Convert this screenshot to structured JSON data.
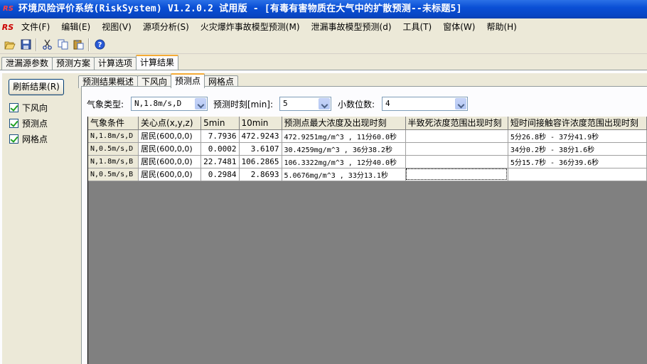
{
  "window": {
    "title": "环境风险评价系统(RiskSystem) V1.2.0.2 试用版 - [有毒有害物质在大气中的扩散预测--未标题5]"
  },
  "menu": [
    "文件(F)",
    "编辑(E)",
    "视图(V)",
    "源项分析(S)",
    "火灾爆炸事故模型预测(M)",
    "泄漏事故模型预测(d)",
    "工具(T)",
    "窗体(W)",
    "帮助(H)"
  ],
  "toolbar": {
    "icons": [
      "open-folder-icon",
      "save-icon",
      "cut-icon",
      "copy-icon",
      "paste-icon",
      "help-icon"
    ]
  },
  "main_tabs": [
    "泄漏源参数",
    "预测方案",
    "计算选项",
    "计算结果"
  ],
  "main_tab_active": "计算结果",
  "left": {
    "refresh_label": "刷新结果(R)",
    "checks": [
      {
        "label": "下风向",
        "checked": true
      },
      {
        "label": "预测点",
        "checked": true
      },
      {
        "label": "网格点",
        "checked": true
      }
    ]
  },
  "sub_tabs": [
    "预测结果概述",
    "下风向",
    "预测点",
    "网格点"
  ],
  "sub_tab_active": "预测点",
  "filters": {
    "weather_label": "气象类型:",
    "weather_value": "N,1.8m/s,D",
    "time_label": "预测时刻[min]:",
    "time_value": "5",
    "decimals_label": "小数位数:",
    "decimals_value": "4"
  },
  "grid": {
    "headers": [
      "气象条件",
      "关心点(x,y,z)",
      "5min",
      "10min",
      "预测点最大浓度及出现时刻",
      "半致死浓度范围出现时刻",
      "短时间接触容许浓度范围出现时刻"
    ],
    "rows": [
      {
        "cond": "N,1.8m/s,D",
        "point": "居民(600,0,0)",
        "t5": "7.7936",
        "t10": "472.9243",
        "max": "472.9251mg/m^3 , 11分60.0秒",
        "lc50": "",
        "stel": "5分26.8秒 - 37分41.9秒"
      },
      {
        "cond": "N,0.5m/s,D",
        "point": "居民(600,0,0)",
        "t5": "0.0002",
        "t10": "3.6107",
        "max": "30.4259mg/m^3 , 36分38.2秒",
        "lc50": "",
        "stel": "34分0.2秒 - 38分1.6秒"
      },
      {
        "cond": "N,1.8m/s,B",
        "point": "居民(600,0,0)",
        "t5": "22.7481",
        "t10": "106.2865",
        "max": "106.3322mg/m^3 , 12分40.0秒",
        "lc50": "",
        "stel": "5分15.7秒 - 36分39.6秒"
      },
      {
        "cond": "N,0.5m/s,B",
        "point": "居民(600,0,0)",
        "t5": "0.2984",
        "t10": "2.8693",
        "max": "5.0676mg/m^3 , 33分13.1秒",
        "lc50": "",
        "stel": ""
      }
    ]
  }
}
